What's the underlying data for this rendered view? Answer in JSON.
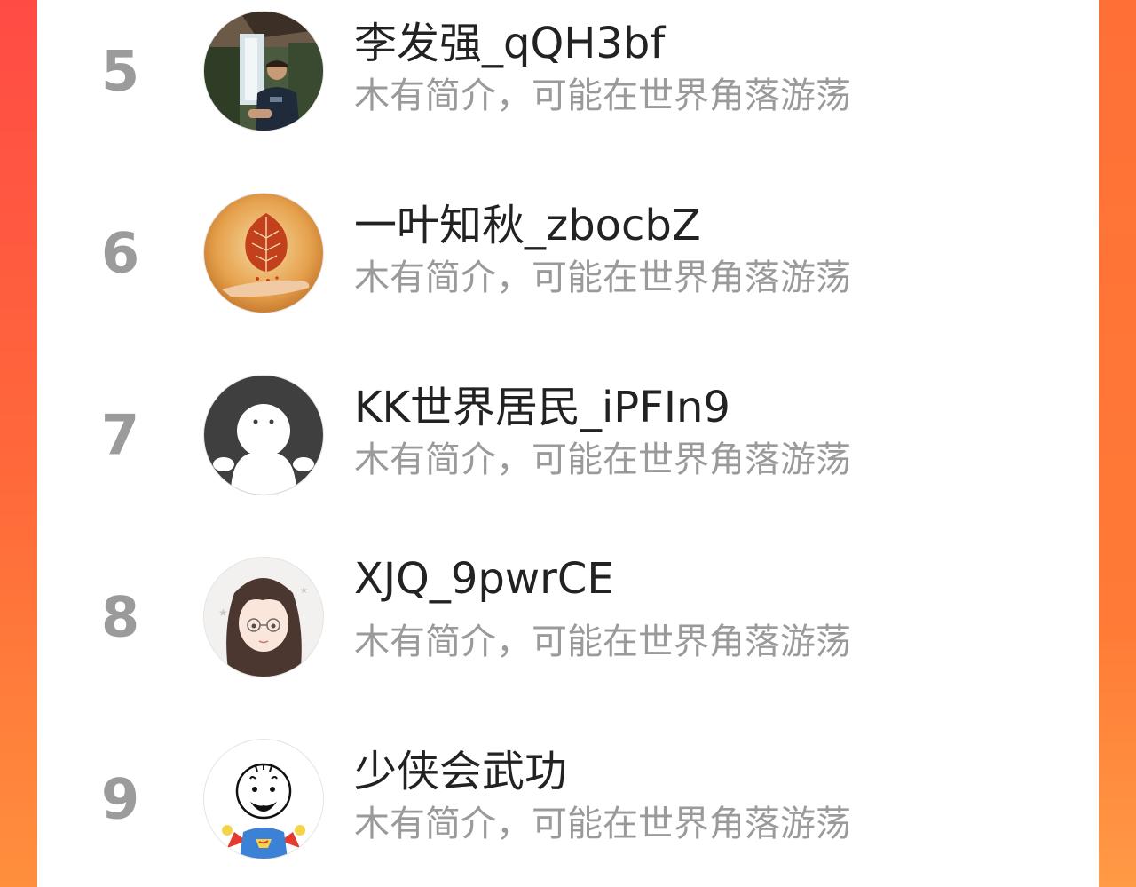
{
  "colors": {
    "background_gradient_start": "#ff4b45",
    "background_gradient_end": "#ff8f3c",
    "card": "#ffffff",
    "rank_number": "#9b9b9b",
    "name": "#222222",
    "bio": "#9a9a9a"
  },
  "ranking": {
    "items": [
      {
        "rank": "5",
        "name": "李发强_qQH3bf",
        "bio": "木有简介，可能在世界角落游荡",
        "avatar_icon": "photo-man-waterfall-avatar"
      },
      {
        "rank": "6",
        "name": "一叶知秋_zbocbZ",
        "bio": "木有简介，可能在世界角落游荡",
        "avatar_icon": "autumn-leaf-hand-avatar"
      },
      {
        "rank": "7",
        "name": "KK世界居民_iPFIn9",
        "bio": "木有简介，可能在世界角落游荡",
        "avatar_icon": "default-ghost-avatar"
      },
      {
        "rank": "8",
        "name": "XJQ_9pwrCE",
        "bio": "木有简介，可能在世界角落游荡",
        "avatar_icon": "anime-girl-avatar"
      },
      {
        "rank": "9",
        "name": "少侠会武功",
        "bio": "木有简介，可能在世界角落游荡",
        "avatar_icon": "cartoon-superman-avatar"
      }
    ]
  }
}
